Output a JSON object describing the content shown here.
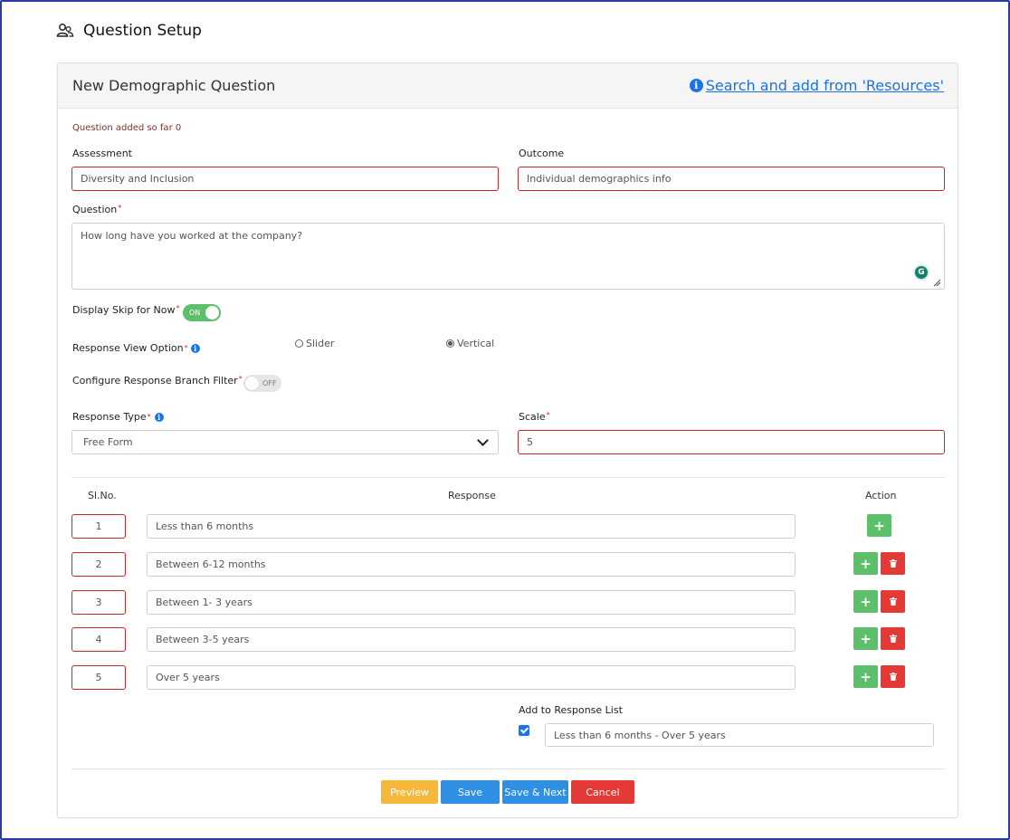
{
  "page": {
    "title": "Question Setup",
    "icon": "users-icon"
  },
  "card": {
    "title": "New Demographic Question",
    "resources_link": "Search and add from 'Resources'"
  },
  "form": {
    "question_count_text": "Question added so far 0",
    "assessment": {
      "label": "Assessment",
      "value": "Diversity and Inclusion"
    },
    "outcome": {
      "label": "Outcome",
      "value": "Individual demographics info"
    },
    "question": {
      "label": "Question",
      "required_mark": "*",
      "value": "How long have you worked at the company?"
    },
    "display_skip": {
      "label": "Display Skip for Now",
      "required_mark": "*",
      "state": "ON"
    },
    "response_view": {
      "label": "Response View Option",
      "required_mark": "*",
      "options": [
        {
          "label": "Slider",
          "selected": false
        },
        {
          "label": "Vertical",
          "selected": true
        }
      ]
    },
    "branch_filter": {
      "label": "Configure Response Branch Filter",
      "required_mark": "*",
      "state": "OFF"
    },
    "response_type": {
      "label": "Response Type",
      "required_mark": "*",
      "value": "Free Form"
    },
    "scale": {
      "label": "Scale",
      "required_mark": "*",
      "value": "5"
    }
  },
  "table": {
    "headers": {
      "slno": "Sl.No.",
      "response": "Response",
      "action": "Action"
    },
    "rows": [
      {
        "no": "1",
        "response": "Less than 6 months"
      },
      {
        "no": "2",
        "response": "Between 6-12 months"
      },
      {
        "no": "3",
        "response": "Between 1- 3 years"
      },
      {
        "no": "4",
        "response": "Between 3-5 years"
      },
      {
        "no": "5",
        "response": "Over 5 years"
      }
    ],
    "add_symbol": "+"
  },
  "response_list": {
    "label": "Add to Response List",
    "checked": true,
    "value": "Less than 6 months - Over 5 years"
  },
  "buttons": {
    "preview": "Preview",
    "save": "Save",
    "save_next": "Save & Next",
    "cancel": "Cancel"
  },
  "colors": {
    "accent": "#1a73e8",
    "error_border": "#c62828",
    "success": "#5cbf6a",
    "danger": "#e53935",
    "warning": "#f6b73c",
    "primary": "#2f8fe3"
  }
}
